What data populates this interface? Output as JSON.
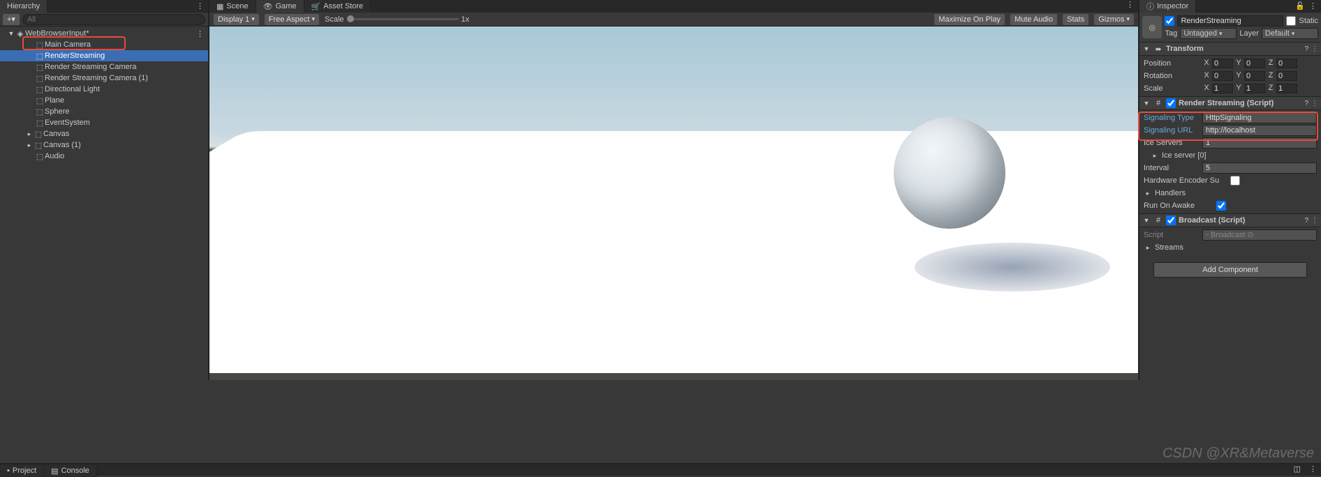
{
  "hierarchy": {
    "tab": "Hierarchy",
    "search_placeholder": "All",
    "scene": "WebBrowserInput*",
    "items": [
      {
        "label": "Main Camera",
        "indent": 1
      },
      {
        "label": "RenderStreaming",
        "indent": 1,
        "selected": true
      },
      {
        "label": "Render Streaming Camera",
        "indent": 1
      },
      {
        "label": "Render Streaming Camera (1)",
        "indent": 1
      },
      {
        "label": "Directional Light",
        "indent": 1
      },
      {
        "label": "Plane",
        "indent": 1
      },
      {
        "label": "Sphere",
        "indent": 1
      },
      {
        "label": "EventSystem",
        "indent": 1
      },
      {
        "label": "Canvas",
        "indent": 0,
        "expandable": true
      },
      {
        "label": "Canvas (1)",
        "indent": 0,
        "expandable": true
      },
      {
        "label": "Audio",
        "indent": 1
      }
    ]
  },
  "center": {
    "tabs": [
      {
        "label": "Scene",
        "icon": "scene-icon"
      },
      {
        "label": "Game",
        "icon": "game-icon",
        "active": true
      },
      {
        "label": "Asset Store",
        "icon": "asset-store-icon"
      }
    ],
    "display": "Display 1",
    "aspect": "Free Aspect",
    "scale_label": "Scale",
    "scale_value": "1x",
    "right_buttons": [
      "Maximize On Play",
      "Mute Audio",
      "Stats",
      "Gizmos"
    ]
  },
  "inspector": {
    "tab": "Inspector",
    "go_name": "RenderStreaming",
    "static_label": "Static",
    "tag_label": "Tag",
    "tag_value": "Untagged",
    "layer_label": "Layer",
    "layer_value": "Default",
    "transform": {
      "title": "Transform",
      "rows": [
        {
          "label": "Position",
          "x": "0",
          "y": "0",
          "z": "0"
        },
        {
          "label": "Rotation",
          "x": "0",
          "y": "0",
          "z": "0"
        },
        {
          "label": "Scale",
          "x": "1",
          "y": "1",
          "z": "1"
        }
      ]
    },
    "render_streaming": {
      "title": "Render Streaming (Script)",
      "signaling_type_label": "Signaling Type",
      "signaling_type_value": "HttpSignaling",
      "signaling_url_label": "Signaling URL",
      "signaling_url_value": "http://localhost",
      "ice_servers_label": "Ice Servers",
      "ice_servers_value": "1",
      "ice_server_item": "Ice server [0]",
      "interval_label": "Interval",
      "interval_value": "5",
      "hw_encoder_label": "Hardware Encoder Su",
      "handlers_label": "Handlers",
      "run_on_awake_label": "Run On Awake"
    },
    "broadcast": {
      "title": "Broadcast (Script)",
      "script_label": "Script",
      "script_value": "Broadcast",
      "streams_label": "Streams"
    },
    "add_component": "Add Component"
  },
  "bottom": {
    "project": "Project",
    "console": "Console"
  },
  "watermark": "CSDN @XR&Metaverse"
}
